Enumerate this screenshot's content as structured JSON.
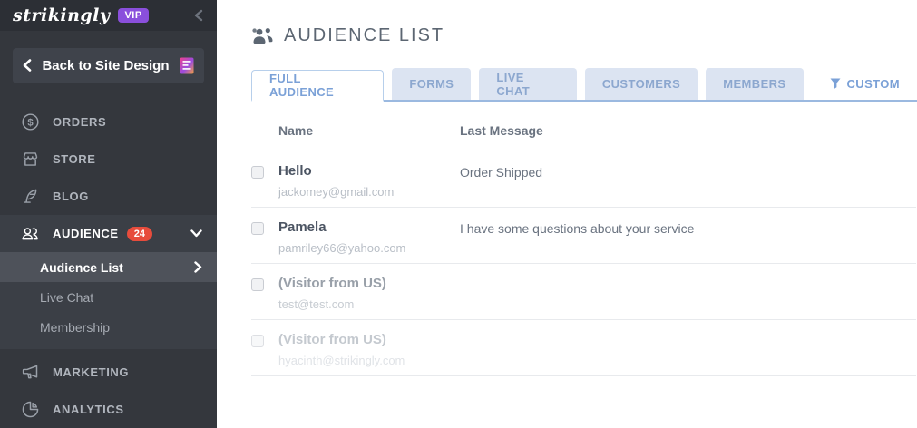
{
  "sidebar": {
    "logo_text": "strikingly",
    "vip_badge": "VIP",
    "back_button_label": "Back to Site Design",
    "items": [
      {
        "label": "ORDERS",
        "icon": "dollar-circle-icon"
      },
      {
        "label": "STORE",
        "icon": "storefront-icon"
      },
      {
        "label": "BLOG",
        "icon": "quill-icon"
      },
      {
        "label": "AUDIENCE",
        "icon": "people-icon",
        "badge": "24",
        "expanded": true
      },
      {
        "label": "MARKETING",
        "icon": "megaphone-icon"
      },
      {
        "label": "ANALYTICS",
        "icon": "pie-chart-icon"
      }
    ],
    "audience_submenu": [
      {
        "label": "Audience List",
        "selected": true
      },
      {
        "label": "Live Chat",
        "selected": false
      },
      {
        "label": "Membership",
        "selected": false
      }
    ]
  },
  "main": {
    "title": "AUDIENCE LIST",
    "tabs": [
      {
        "label": "FULL AUDIENCE",
        "state": "active"
      },
      {
        "label": "FORMS",
        "state": "inactive"
      },
      {
        "label": "LIVE CHAT",
        "state": "inactive"
      },
      {
        "label": "CUSTOMERS",
        "state": "inactive"
      },
      {
        "label": "MEMBERS",
        "state": "inactive"
      },
      {
        "label": "CUSTOM",
        "state": "plain",
        "icon": "funnel-icon"
      }
    ],
    "table": {
      "columns": {
        "name": "Name",
        "last_message": "Last Message"
      },
      "rows": [
        {
          "name": "Hello",
          "email": "jackomey@gmail.com",
          "last_message": "Order Shipped",
          "state": "normal"
        },
        {
          "name": "Pamela",
          "email": "pamriley66@yahoo.com",
          "last_message": "I have some questions about your service",
          "state": "normal"
        },
        {
          "name": "(Visitor from US)",
          "email": "test@test.com",
          "last_message": "",
          "state": "muted"
        },
        {
          "name": "(Visitor from US)",
          "email": "hyacinth@strikingly.com",
          "last_message": "",
          "state": "faded"
        }
      ]
    }
  },
  "colors": {
    "sidebar_bg": "#34373d",
    "sidebar_section_bg": "#3b3f46",
    "sidebar_selected_bg": "#4e525a",
    "vip_purple": "#8a4fdc",
    "badge_red": "#e74c3c",
    "tab_blue_text": "#7ba1d7",
    "tab_inactive_bg": "#dce4f2",
    "tab_underline": "#9bb9e0",
    "title_gray": "#5c6672"
  }
}
